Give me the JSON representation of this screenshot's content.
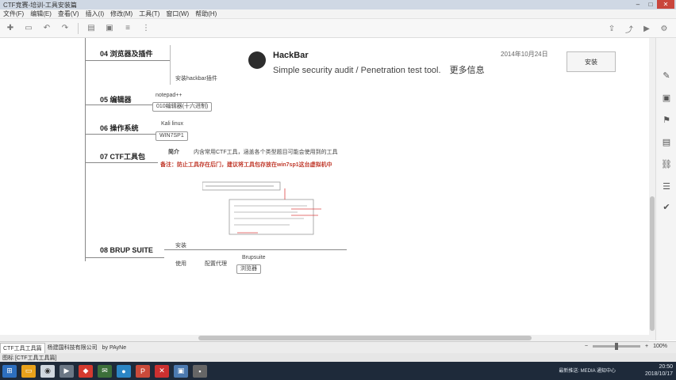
{
  "window": {
    "title": "CTF竞赛-培训-工具安装篇"
  },
  "menu": [
    "文件(F)",
    "编辑(E)",
    "查看(V)",
    "插入(I)",
    "修改(M)",
    "工具(T)",
    "窗口(W)",
    "帮助(H)"
  ],
  "toolbar": {
    "icons": [
      "plus-icon",
      "document-icon",
      "undo-icon",
      "redo-icon",
      "folder-icon",
      "image-icon",
      "align-icon",
      "more-icon"
    ]
  },
  "mindmap": {
    "sections": [
      {
        "id": "04",
        "label": "04 浏览器及插件",
        "children": [
          "安装hackbar插件"
        ]
      },
      {
        "id": "05",
        "label": "05 编辑器",
        "children": [
          "notepad++",
          "010编辑器(十六进制)"
        ]
      },
      {
        "id": "06",
        "label": "06 操作系统",
        "children": [
          "Kali linux",
          "WIN7SP1"
        ]
      },
      {
        "id": "07",
        "label": "07 CTF工具包",
        "intro_label": "简介",
        "intro_text": "内含常用CTF工具，涵盖各个类型题目可能会使用到的工具",
        "note": "备注：防止工具存在后门，建议将工具包存放在win7sp1这台虚拟机中"
      },
      {
        "id": "08",
        "label": "08 BRUP SUITE",
        "children": [
          "安装",
          "使用",
          "配置代理",
          "Brupsuite",
          "浏览器"
        ]
      }
    ]
  },
  "hackbar": {
    "name": "HackBar",
    "description": "Simple security audit / Penetration test tool.",
    "more_link": "更多信息",
    "date": "2014年10月24日",
    "install_button": "安装"
  },
  "tabs": [
    "CTF工具工具篇",
    "杨建国科技有限公司",
    "by PAyNe"
  ],
  "zoom": {
    "label": "100%"
  },
  "status": {
    "text": "图标 [CTF工具工具篇]"
  },
  "taskbar": {
    "time": "20:50",
    "date": "2018/10/17",
    "tray_info": "最新推送: MEDIA 通知中心"
  },
  "colors": {
    "note_red": "#c0392b",
    "taskbar_bg": "#1e2a3a",
    "close_red": "#c9463d"
  }
}
